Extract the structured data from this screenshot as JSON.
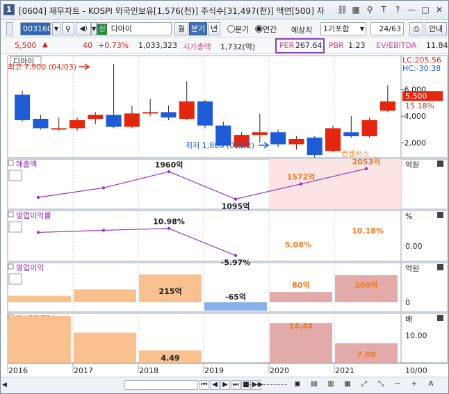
{
  "window": {
    "number": "1",
    "title": "[0604] 재무차트 - KOSPI 외국인보유[1,576(천)] 주식수[31,497(천)] 액면[500] 자",
    "icons": [
      "link-icon",
      "grid-icon",
      "pin-icon",
      "font-icon",
      "help-icon",
      "minimize-icon",
      "maximize-icon",
      "close-icon"
    ],
    "icon_glyphs": [
      "⛓",
      "▦",
      "⚲",
      "T",
      "?",
      "—",
      "□",
      "✕"
    ]
  },
  "toolbar": {
    "code": "003160",
    "new_badge": "신",
    "stock_name": "디아이",
    "month_label": "월",
    "quarter_label": "분기",
    "year_label": "년",
    "radio_quarter": "분기",
    "radio_annual": "연간",
    "estimate_label": "예상치",
    "estimate_select": "1기포함",
    "page_counter": "24/63",
    "guide_label": "안내"
  },
  "info": {
    "price": "5,500",
    "change": "40",
    "change_pct": "+0.73%",
    "volume": "1,033,323",
    "market_cap_label": "시가총액",
    "market_cap": "1,732(억)",
    "per_label": "PER",
    "per": "267.64",
    "pbr_label": "PBR",
    "pbr": "1.23",
    "ev_label": "EV/EBITDA",
    "ev": "11.84"
  },
  "price_panel": {
    "label": "디아이",
    "high_text": "최고 7,900 (04/03)",
    "low_text": "최저 1,800 (01/02)",
    "lc": "LC:205.56",
    "hc": "HC:-30.38",
    "current_price": "5,500",
    "current_pct": "15.18%",
    "y_ticks": [
      "6,000",
      "4,000",
      "2,000"
    ],
    "candles": [
      {
        "o": 5600,
        "c": 3700,
        "h": 5900,
        "l": 3600
      },
      {
        "o": 3800,
        "c": 3100,
        "h": 4100,
        "l": 3000
      },
      {
        "o": 3100,
        "c": 3100,
        "h": 3900,
        "l": 2900
      },
      {
        "o": 3100,
        "c": 3700,
        "h": 3900,
        "l": 2900
      },
      {
        "o": 3800,
        "c": 4100,
        "h": 4300,
        "l": 3400
      },
      {
        "o": 4100,
        "c": 3200,
        "h": 7900,
        "l": 3100
      },
      {
        "o": 3200,
        "c": 4200,
        "h": 4800,
        "l": 3100
      },
      {
        "o": 4200,
        "c": 4300,
        "h": 5300,
        "l": 4000
      },
      {
        "o": 4300,
        "c": 3900,
        "h": 4800,
        "l": 3700
      },
      {
        "o": 3800,
        "c": 5100,
        "h": 6600,
        "l": 3700
      },
      {
        "o": 5100,
        "c": 3300,
        "h": 5200,
        "l": 3100
      },
      {
        "o": 3300,
        "c": 1800,
        "h": 3600,
        "l": 1700
      },
      {
        "o": 1700,
        "c": 2600,
        "h": 2800,
        "l": 1600
      },
      {
        "o": 2600,
        "c": 2800,
        "h": 4200,
        "l": 2000
      },
      {
        "o": 2800,
        "c": 1900,
        "h": 3000,
        "l": 1700
      },
      {
        "o": 1900,
        "c": 2300,
        "h": 2500,
        "l": 1500
      },
      {
        "o": 2400,
        "c": 1100,
        "h": 2500,
        "l": 900
      },
      {
        "o": 1400,
        "c": 3100,
        "h": 3300,
        "l": 1300
      },
      {
        "o": 2800,
        "c": 2500,
        "h": 4000,
        "l": 2400
      },
      {
        "o": 2500,
        "c": 3700,
        "h": 3900,
        "l": 2400
      },
      {
        "o": 4400,
        "c": 5100,
        "h": 6300,
        "l": 4300
      }
    ]
  },
  "consensus_label": "컨센서스",
  "sales_panel": {
    "label": "매출액",
    "unit": "억원",
    "values": [
      null,
      1150,
      1450,
      1960,
      1095,
      1572,
      2053
    ],
    "data_labels": [
      "",
      "",
      "",
      "1960억",
      "1095억",
      "1572억",
      "2053억"
    ]
  },
  "op_margin_panel": {
    "label": "영업이익률",
    "unit": "%",
    "zero_tick": "0.00",
    "values": [
      null,
      8.5,
      9.8,
      10.98,
      -5.97,
      5.08,
      10.18
    ],
    "data_labels": [
      "",
      "",
      "",
      "10.98%",
      "-5.97%",
      "5.08%",
      "10.18%"
    ]
  },
  "op_profit_panel": {
    "label": "영업이익",
    "unit": "억원",
    "zero_tick": "0",
    "values": [
      50,
      100,
      215,
      -65,
      80,
      209
    ],
    "data_labels": [
      "",
      "",
      "215억",
      "-65억",
      "80억",
      "209억"
    ]
  },
  "ev_panel": {
    "label": "EV/EBITDA",
    "unit": "배",
    "tick": "10.00",
    "values": [
      17,
      11,
      4.49,
      null,
      14.44,
      7.08
    ],
    "data_labels": [
      "",
      "",
      "4.49",
      "",
      "14.44",
      "7.08"
    ]
  },
  "x_axis": {
    "years": [
      "2016",
      "2017",
      "2018",
      "2019",
      "2020",
      "2021"
    ],
    "date_tick": "10/00"
  },
  "colors": {
    "up": "#e4260f",
    "down": "#1f5bd4",
    "bar_fill": "#f9c18f",
    "bar_neg": "#8ab0e8",
    "consensus_fill": "#fde4e4",
    "consensus_bar": "#e2aaa8",
    "line": "#9b30c8",
    "label_orange": "#f07a23"
  },
  "bottom_bar": {
    "buttons": [
      "⏮",
      "◀",
      "▶",
      "⏭",
      "■",
      "▶▶"
    ],
    "right_buttons": [
      "▣",
      "▤",
      "▥",
      "▦",
      "⤢",
      "⤡",
      "−",
      "+",
      "A"
    ]
  }
}
